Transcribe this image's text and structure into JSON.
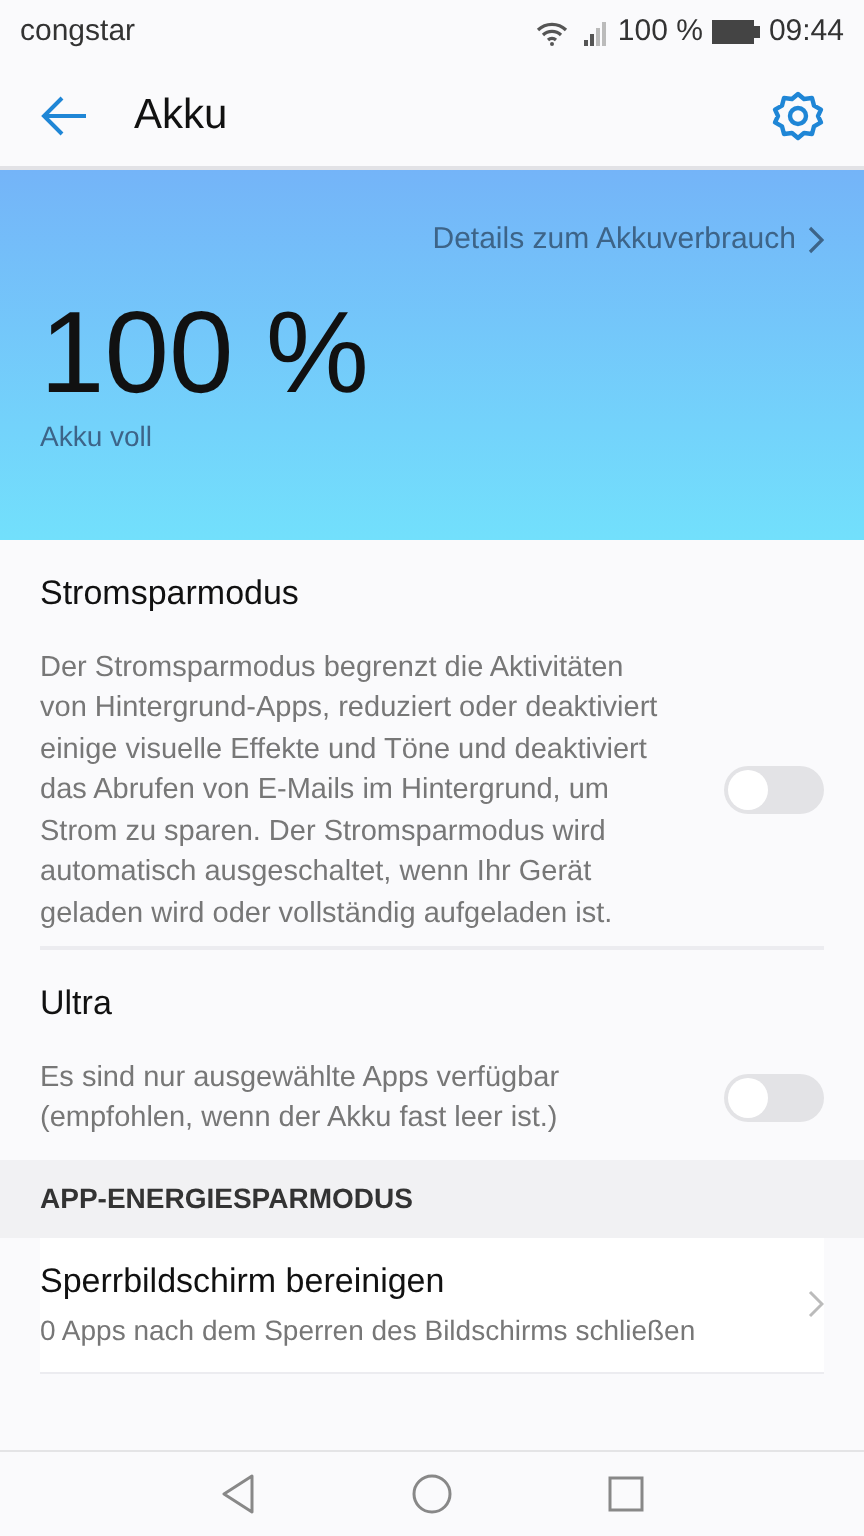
{
  "status_bar": {
    "carrier": "congstar",
    "battery_text": "100 %",
    "time": "09:44"
  },
  "header": {
    "title": "Akku"
  },
  "hero": {
    "details_link": "Details zum Akkuverbrauch",
    "percent": "100 %",
    "status": "Akku voll"
  },
  "toggles": [
    {
      "title": "Stromsparmodus",
      "description": "Der Stromsparmodus begrenzt die Aktivitäten von Hintergrund-Apps, reduziert oder deaktiviert einige visuelle Effekte und Töne und deaktiviert das Abrufen von E-Mails im Hintergrund, um Strom zu sparen. Der Stromsparmodus wird automatisch ausgeschaltet, wenn Ihr Gerät geladen wird oder vollständig aufgeladen ist.",
      "on": false
    },
    {
      "title": "Ultra",
      "description": "Es sind nur ausgewählte Apps verfügbar (empfohlen, wenn der Akku fast leer ist.)",
      "on": false
    }
  ],
  "section": {
    "title": "APP-ENERGIESPARMODUS"
  },
  "list_items": [
    {
      "title": "Sperrbildschirm bereinigen",
      "subtitle": "0 Apps nach dem Sperren des Bildschirms schließen"
    }
  ]
}
